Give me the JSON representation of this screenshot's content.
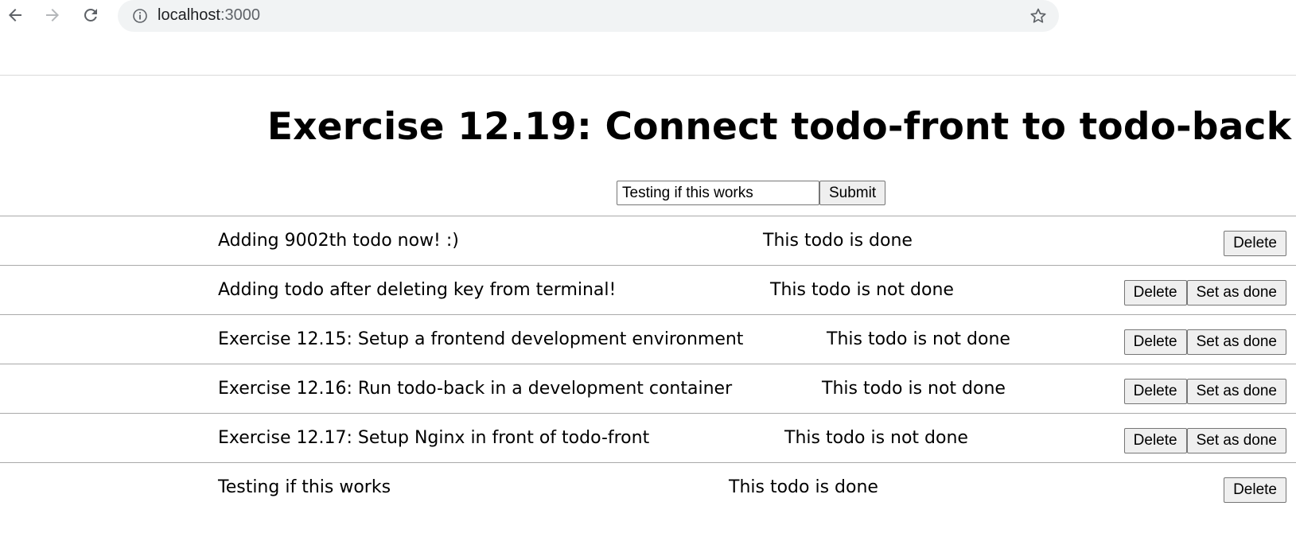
{
  "browser": {
    "url_host": "localhost",
    "url_port": ":3000"
  },
  "page": {
    "title": "Exercise 12.19: Connect todo-front to todo-back"
  },
  "form": {
    "input_value": "Testing if this works",
    "submit_label": "Submit"
  },
  "todos": [
    {
      "text": "Adding 9002th todo now! :)",
      "status": "This todo is done",
      "done": true,
      "delete_label": "Delete"
    },
    {
      "text": "Adding todo after deleting key from terminal!",
      "status": "This todo is not done",
      "done": false,
      "delete_label": "Delete",
      "set_done_label": "Set as done"
    },
    {
      "text": "Exercise 12.15: Setup a frontend development environment",
      "status": "This todo is not done",
      "done": false,
      "delete_label": "Delete",
      "set_done_label": "Set as done"
    },
    {
      "text": "Exercise 12.16: Run todo-back in a development container",
      "status": "This todo is not done",
      "done": false,
      "delete_label": "Delete",
      "set_done_label": "Set as done"
    },
    {
      "text": "Exercise 12.17: Setup Nginx in front of todo-front",
      "status": "This todo is not done",
      "done": false,
      "delete_label": "Delete",
      "set_done_label": "Set as done"
    },
    {
      "text": "Testing if this works",
      "status": "This todo is done",
      "done": true,
      "delete_label": "Delete"
    }
  ],
  "icons": {
    "back": "back-arrow-icon",
    "forward": "forward-arrow-icon",
    "reload": "reload-icon",
    "info": "info-icon",
    "bookmark": "star-icon"
  }
}
